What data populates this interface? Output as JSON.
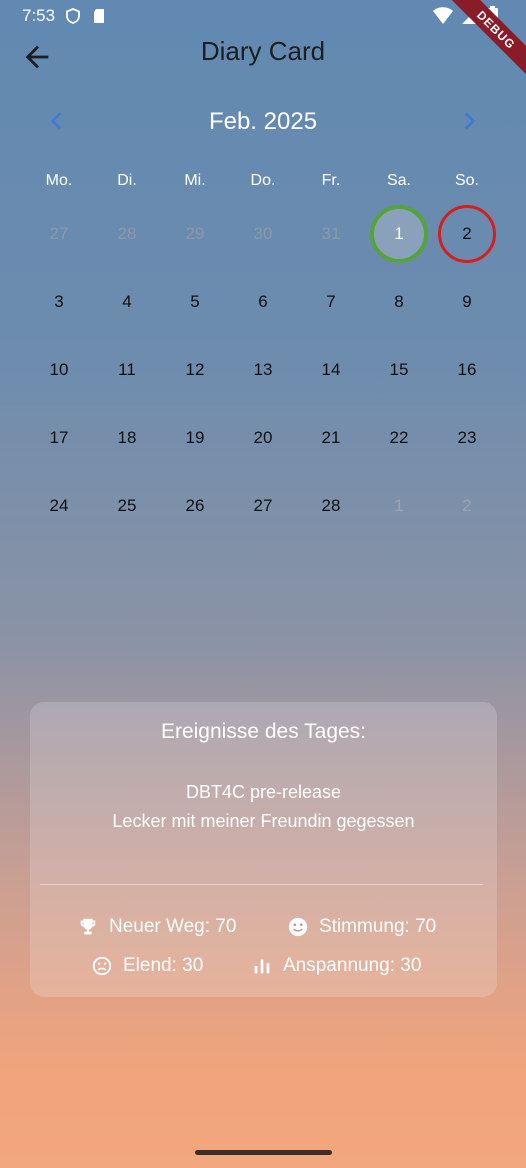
{
  "status_bar": {
    "time": "7:53"
  },
  "debug_banner": "DEBUG",
  "app_bar": {
    "title": "Diary Card"
  },
  "calendar": {
    "month_label": "Feb. 2025",
    "weekdays": [
      "Mo.",
      "Di.",
      "Mi.",
      "Do.",
      "Fr.",
      "Sa.",
      "So."
    ],
    "weeks": [
      [
        "27",
        "28",
        "29",
        "30",
        "31",
        "1",
        "2"
      ],
      [
        "3",
        "4",
        "5",
        "6",
        "7",
        "8",
        "9"
      ],
      [
        "10",
        "11",
        "12",
        "13",
        "14",
        "15",
        "16"
      ],
      [
        "17",
        "18",
        "19",
        "20",
        "21",
        "22",
        "23"
      ],
      [
        "24",
        "25",
        "26",
        "27",
        "28",
        "1",
        "2"
      ]
    ],
    "selected_day": "1",
    "marked_day": "2"
  },
  "events": {
    "title": "Ereignisse des Tages:",
    "items": [
      "DBT4C pre-release",
      "Lecker mit meiner Freundin gegessen"
    ],
    "stats": {
      "neuer_weg": "Neuer Weg: 70",
      "stimmung": "Stimmung: 70",
      "elend": "Elend: 30",
      "anspannung": "Anspannung: 30"
    }
  },
  "colors": {
    "selected_ring": "#55a43a",
    "marked_ring": "#d3201d",
    "nav_arrow": "#3a7bd5"
  }
}
